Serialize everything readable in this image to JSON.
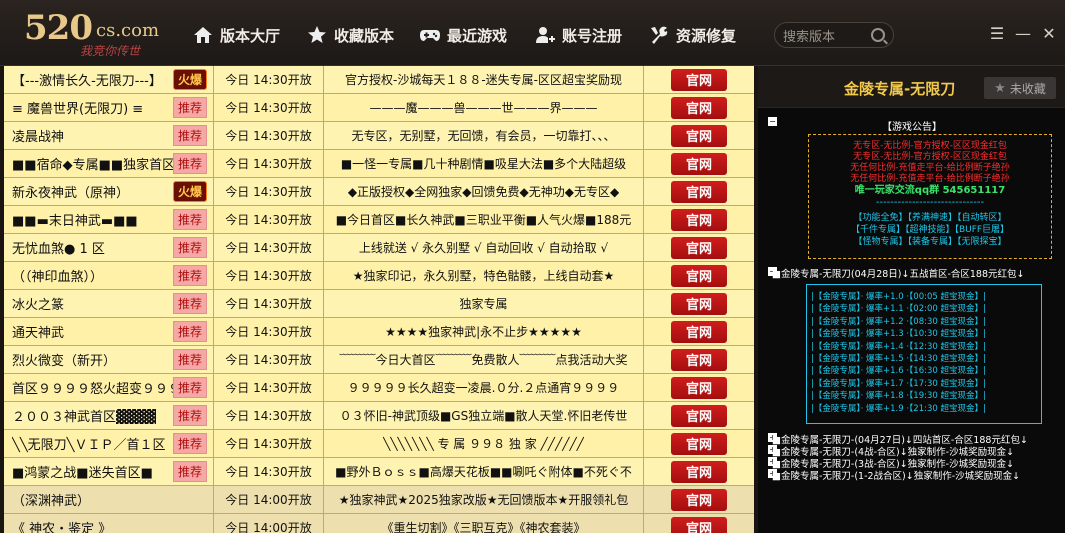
{
  "brand": {
    "logo_main": "520",
    "logo_domain": "cs.com",
    "slogan": "我竞你传世"
  },
  "nav": [
    {
      "label": "版本大厅",
      "icon": "home-icon"
    },
    {
      "label": "收藏版本",
      "icon": "star-icon"
    },
    {
      "label": "最近游戏",
      "icon": "gamepad-icon"
    },
    {
      "label": "账号注册",
      "icon": "user-add-icon"
    },
    {
      "label": "资源修复",
      "icon": "wrench-icon"
    }
  ],
  "search": {
    "placeholder": "搜索版本"
  },
  "rows": [
    {
      "name": "【---激情长久-无限刀---】",
      "tag": "火爆",
      "tagtype": "fire",
      "time": "今日 14:30开放",
      "desc": "官方授权-沙城每天１８８-迷失专属-区区超宝奖励现",
      "btn": "官网"
    },
    {
      "name": "≡  魔兽世界(无限刀)  ≡",
      "tag": "推荐",
      "tagtype": "rec",
      "time": "今日 14:30开放",
      "desc": "———魔———兽———世———界———",
      "btn": "官网"
    },
    {
      "name": "凌晨战神",
      "tag": "推荐",
      "tagtype": "rec",
      "time": "今日 14:30开放",
      "desc": "无专区，无别墅，无回馈，有会员，一切靠打、、、",
      "btn": "官网"
    },
    {
      "name": "■■宿命◆专属■■独家首区",
      "tag": "推荐",
      "tagtype": "rec",
      "time": "今日 14:30开放",
      "desc": "■一怪一专属■几十种剧情■吸星大法■多个大陆超级",
      "btn": "官网"
    },
    {
      "name": "新永夜神武（原神）",
      "tag": "火爆",
      "tagtype": "fire",
      "time": "今日 14:30开放",
      "desc": "◆正版授权◆全网独家◆回馈免费◆无神功◆无专区◆",
      "btn": "官网"
    },
    {
      "name": "■■▬末日神武▬■■",
      "tag": "推荐",
      "tagtype": "rec",
      "time": "今日 14:30开放",
      "desc": "■今日首区■长久神武■三职业平衡■人气火爆■188元",
      "btn": "官网"
    },
    {
      "name": "无忧血煞● 1 区",
      "tag": "推荐",
      "tagtype": "rec",
      "time": "今日 14:30开放",
      "desc": "上线就送 √   永久别墅 √   自动回收 √   自动拾取 √",
      "btn": "官网"
    },
    {
      "name": "（（神印血煞））",
      "tag": "推荐",
      "tagtype": "rec",
      "time": "今日 14:30开放",
      "desc": "★独家印记，永久别墅，特色骷髅，上线自动套★",
      "btn": "官网"
    },
    {
      "name": "冰火之篆",
      "tag": "推荐",
      "tagtype": "rec",
      "time": "今日 14:30开放",
      "desc": "独家专属",
      "btn": "官网"
    },
    {
      "name": "通天神武",
      "tag": "推荐",
      "tagtype": "rec",
      "time": "今日 14:30开放",
      "desc": "★★★★独家神武|永不止步★★★★★",
      "btn": "官网"
    },
    {
      "name": "烈火微变（新开）",
      "tag": "推荐",
      "tagtype": "rec",
      "time": "今日 14:30开放",
      "desc": "﹋﹋﹋今日大首区﹋﹋﹋免费散人﹋﹋﹋点我活动大奖",
      "btn": "官网"
    },
    {
      "name": "首区９９９９怒火超变９９９",
      "tag": "推荐",
      "tagtype": "rec",
      "time": "今日 14:30开放",
      "desc": "９９９９９长久超变一凌晨.０分.２点通宵９９９９",
      "btn": "官网"
    },
    {
      "name": "２００３神武首区▓▓▓▓",
      "tag": "推荐",
      "tagtype": "rec",
      "time": "今日 14:30开放",
      "desc": "０３怀旧-神武顶级■GS独立端■散人天堂.怀旧老传世",
      "btn": "官网"
    },
    {
      "name": "╲╲无限刀╲ＶＩＰ／首１区",
      "tag": "推荐",
      "tagtype": "rec",
      "time": "今日 14:30开放",
      "desc": "╲╲╲╲╲╲╲  专 属 ９９８ 独 家 ╱╱╱╱╱╱",
      "btn": "官网"
    },
    {
      "name": "■鸿蒙之战■迷失首区■",
      "tag": "推荐",
      "tagtype": "rec",
      "time": "今日 14:30开放",
      "desc": "■野外Ｂｏｓｓ■高爆天花板■■唰吒ぐ附体■不死ぐ不",
      "btn": "官网"
    },
    {
      "name": "（深渊神武）",
      "tag": "",
      "tagtype": "",
      "time": "今日 14:00开放",
      "desc": "★独家神武★2025独家改版★无回馈版本★开服领礼包",
      "btn": "官网"
    },
    {
      "name": "《  神农・鉴定  》",
      "tag": "",
      "tagtype": "",
      "time": "今日 14:00开放",
      "desc": "《重生切割》《三职互克》《神农套装》",
      "btn": "官网"
    }
  ],
  "panel": {
    "title": "金陵专属-无限刀",
    "fav_label": "未收藏",
    "notice_title": "【游戏公告】",
    "notice_red": [
      "无专区-无比例-官方授权-区区现金红包",
      "无专区-无比例-官方授权-区区现金红包",
      "无任何比例-充值走平台-给比例断子绝孙",
      "无任何比例-充值走平台-给比例断子绝孙"
    ],
    "notice_qq": "唯一玩家交流qq群 545651117",
    "notice_dashes": "------------------------------",
    "features": [
      "【功能全免】【养满神速】【自动转区】",
      "【千件专属】【超神技能】【BUFF巨屠】",
      "【怪物专属】【装备专属】【无限探宝】"
    ],
    "server_main": "■金陵专属-无限刀(04月28日)↓五战首区-合区188元红包↓",
    "server_lines": [
      "|【金陵专属】· 爆率+1.0 ·【00:05 超宝现金】|",
      "|【金陵专属】· 爆率+1.1 ·【02:00 超宝现金】|",
      "|【金陵专属】· 爆率+1.2 ·【08:30 超宝现金】|",
      "|【金陵专属】· 爆率+1.3 ·【10:30 超宝现金】|",
      "|【金陵专属】· 爆率+1.4 ·【12:30 超宝现金】|",
      "|【金陵专属】· 爆率+1.5 ·【14:30 超宝现金】|",
      "|【金陵专属】· 爆率+1.6 ·【16:30 超宝现金】|",
      "|【金陵专属】· 爆率+1.7 ·【17:30 超宝现金】|",
      "|【金陵专属】· 爆率+1.8 ·【19:30 超宝现金】|",
      "|【金陵专属】· 爆率+1.9 ·【21:30 超宝现金】|"
    ],
    "server_more": [
      "■金陵专属-无限刀-(04月27日)↓四站首区-合区188元红包↓",
      "■金陵专属-无限刀-(4战-合区)↓独家制作-沙城奖励现金↓",
      "■金陵专属-无限刀-(3战-合区)↓独家制作-沙城奖励现金↓",
      "■金陵专属-无限刀-(1-2战合区)↓独家制作-沙城奖励现金↓"
    ]
  }
}
